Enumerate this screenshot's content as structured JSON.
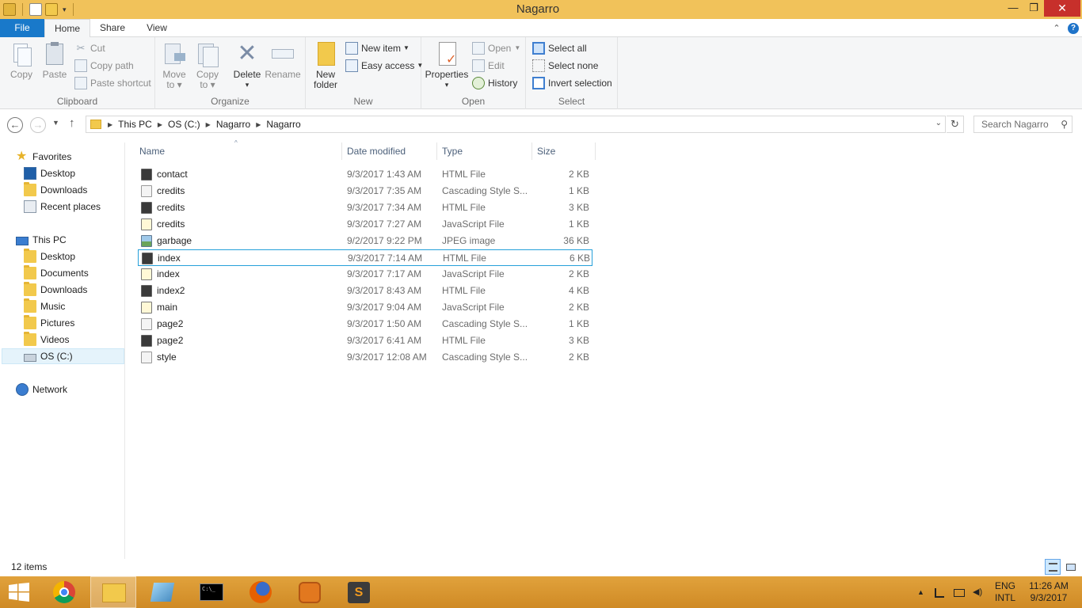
{
  "window": {
    "title": "Nagarro"
  },
  "ribbon_tabs": [
    "File",
    "Home",
    "Share",
    "View"
  ],
  "clipboard": {
    "copy": "Copy",
    "paste": "Paste",
    "cut": "Cut",
    "copy_path": "Copy path",
    "paste_shortcut": "Paste shortcut",
    "label": "Clipboard"
  },
  "organize": {
    "move_to_1": "Move",
    "move_to_2": "to",
    "copy_to_1": "Copy",
    "copy_to_2": "to",
    "delete": "Delete",
    "rename": "Rename",
    "label": "Organize"
  },
  "new_group": {
    "new_folder_1": "New",
    "new_folder_2": "folder",
    "new_item": "New item",
    "easy_access": "Easy access",
    "label": "New"
  },
  "open_group": {
    "properties": "Properties",
    "open": "Open",
    "edit": "Edit",
    "history": "History",
    "label": "Open"
  },
  "select_group": {
    "select_all": "Select all",
    "select_none": "Select none",
    "invert": "Invert selection",
    "label": "Select"
  },
  "breadcrumb": [
    "This PC",
    "OS (C:)",
    "Nagarro",
    "Nagarro"
  ],
  "search": {
    "placeholder": "Search Nagarro"
  },
  "nav": {
    "favorites": "Favorites",
    "fav_items": [
      "Desktop",
      "Downloads",
      "Recent places"
    ],
    "this_pc": "This PC",
    "pc_items": [
      "Desktop",
      "Documents",
      "Downloads",
      "Music",
      "Pictures",
      "Videos",
      "OS (C:)"
    ],
    "network": "Network"
  },
  "columns": {
    "name": "Name",
    "date": "Date modified",
    "type": "Type",
    "size": "Size"
  },
  "files": [
    {
      "name": "contact",
      "date": "9/3/2017 1:43 AM",
      "type": "HTML File",
      "size": "2 KB",
      "kind": "html"
    },
    {
      "name": "credits",
      "date": "9/3/2017 7:35 AM",
      "type": "Cascading Style S...",
      "size": "1 KB",
      "kind": "css"
    },
    {
      "name": "credits",
      "date": "9/3/2017 7:34 AM",
      "type": "HTML File",
      "size": "3 KB",
      "kind": "html"
    },
    {
      "name": "credits",
      "date": "9/3/2017 7:27 AM",
      "type": "JavaScript File",
      "size": "1 KB",
      "kind": "js"
    },
    {
      "name": "garbage",
      "date": "9/2/2017 9:22 PM",
      "type": "JPEG image",
      "size": "36 KB",
      "kind": "jpg"
    },
    {
      "name": "index",
      "date": "9/3/2017 7:14 AM",
      "type": "HTML File",
      "size": "6 KB",
      "kind": "html"
    },
    {
      "name": "index",
      "date": "9/3/2017 7:17 AM",
      "type": "JavaScript File",
      "size": "2 KB",
      "kind": "js"
    },
    {
      "name": "index2",
      "date": "9/3/2017 8:43 AM",
      "type": "HTML File",
      "size": "4 KB",
      "kind": "html"
    },
    {
      "name": "main",
      "date": "9/3/2017 9:04 AM",
      "type": "JavaScript File",
      "size": "2 KB",
      "kind": "js"
    },
    {
      "name": "page2",
      "date": "9/3/2017 1:50 AM",
      "type": "Cascading Style S...",
      "size": "1 KB",
      "kind": "css"
    },
    {
      "name": "page2",
      "date": "9/3/2017 6:41 AM",
      "type": "HTML File",
      "size": "3 KB",
      "kind": "html"
    },
    {
      "name": "style",
      "date": "9/3/2017 12:08 AM",
      "type": "Cascading Style S...",
      "size": "2 KB",
      "kind": "css"
    }
  ],
  "status": {
    "items": "12 items"
  },
  "taskbar": {
    "lang_1": "ENG",
    "lang_2": "INTL",
    "time": "11:26 AM",
    "date": "9/3/2017"
  }
}
